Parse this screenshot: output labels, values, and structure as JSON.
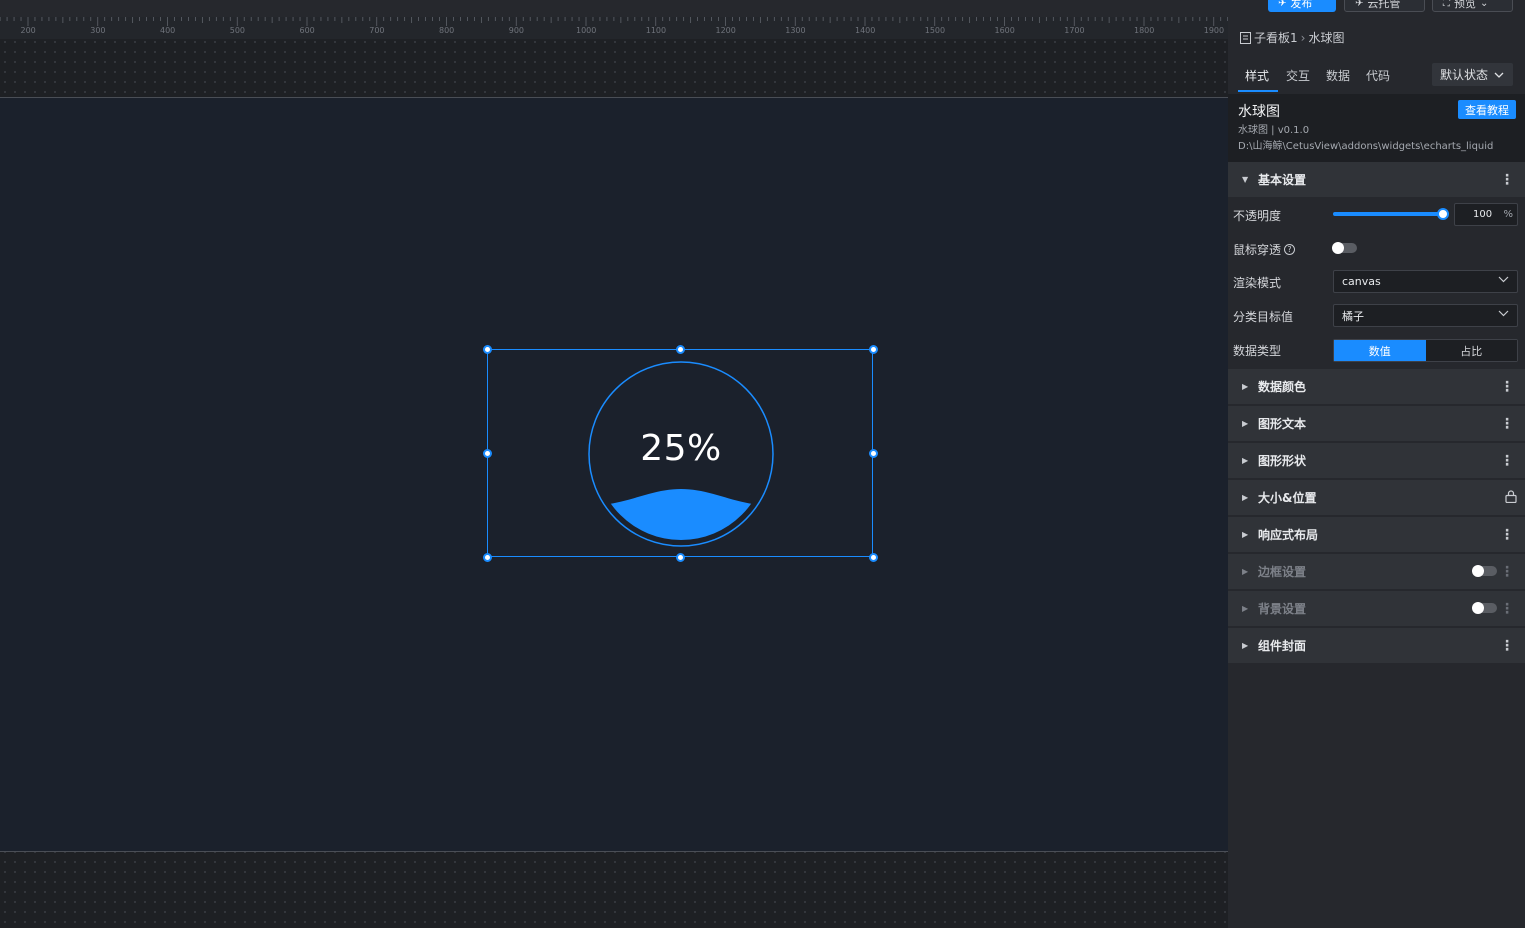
{
  "toolbar": {
    "publish_label": "发布",
    "cloud_label": "云托管",
    "preview_label": "预览"
  },
  "ruler": {
    "labels": [
      "200",
      "300",
      "400",
      "500",
      "600",
      "700",
      "800",
      "900",
      "1000",
      "1100",
      "1200",
      "1300",
      "1400",
      "1500",
      "1600",
      "1700",
      "1800",
      "1900"
    ]
  },
  "widget": {
    "value_text": "25%",
    "fill_fraction": 0.25,
    "color": "#1a8cff"
  },
  "panel": {
    "breadcrumb": {
      "parent": "子看板1",
      "current": "水球图"
    },
    "tabs": [
      "样式",
      "交互",
      "数据",
      "代码"
    ],
    "active_tab": "样式",
    "state_select": "默认状态",
    "component": {
      "title": "水球图",
      "subtitle": "水球图 | v0.1.0",
      "path": "D:\\山海鲸\\CetusView\\addons\\widgets\\echarts_liquid",
      "tutorial_button": "查看教程"
    },
    "basic": {
      "title": "基本设置",
      "opacity_label": "不透明度",
      "opacity_value": "100",
      "opacity_unit": "%",
      "mouse_through_label": "鼠标穿透",
      "render_mode_label": "渲染模式",
      "render_mode_value": "canvas",
      "category_label": "分类目标值",
      "category_value": "橘子",
      "data_type_label": "数据类型",
      "data_type_options": [
        "数值",
        "占比"
      ],
      "data_type_selected": "数值"
    },
    "sections": [
      {
        "label": "数据颜色",
        "dim": false,
        "control": "more"
      },
      {
        "label": "图形文本",
        "dim": false,
        "control": "more"
      },
      {
        "label": "图形形状",
        "dim": false,
        "control": "more"
      },
      {
        "label": "大小&位置",
        "dim": false,
        "control": "lock"
      },
      {
        "label": "响应式布局",
        "dim": false,
        "control": "more"
      },
      {
        "label": "边框设置",
        "dim": true,
        "control": "toggle"
      },
      {
        "label": "背景设置",
        "dim": true,
        "control": "toggle"
      },
      {
        "label": "组件封面",
        "dim": false,
        "control": "more"
      }
    ]
  },
  "colors": {
    "accent": "#1a8cff",
    "panel_bg": "#26282d",
    "screen_bg": "#1b212c"
  }
}
